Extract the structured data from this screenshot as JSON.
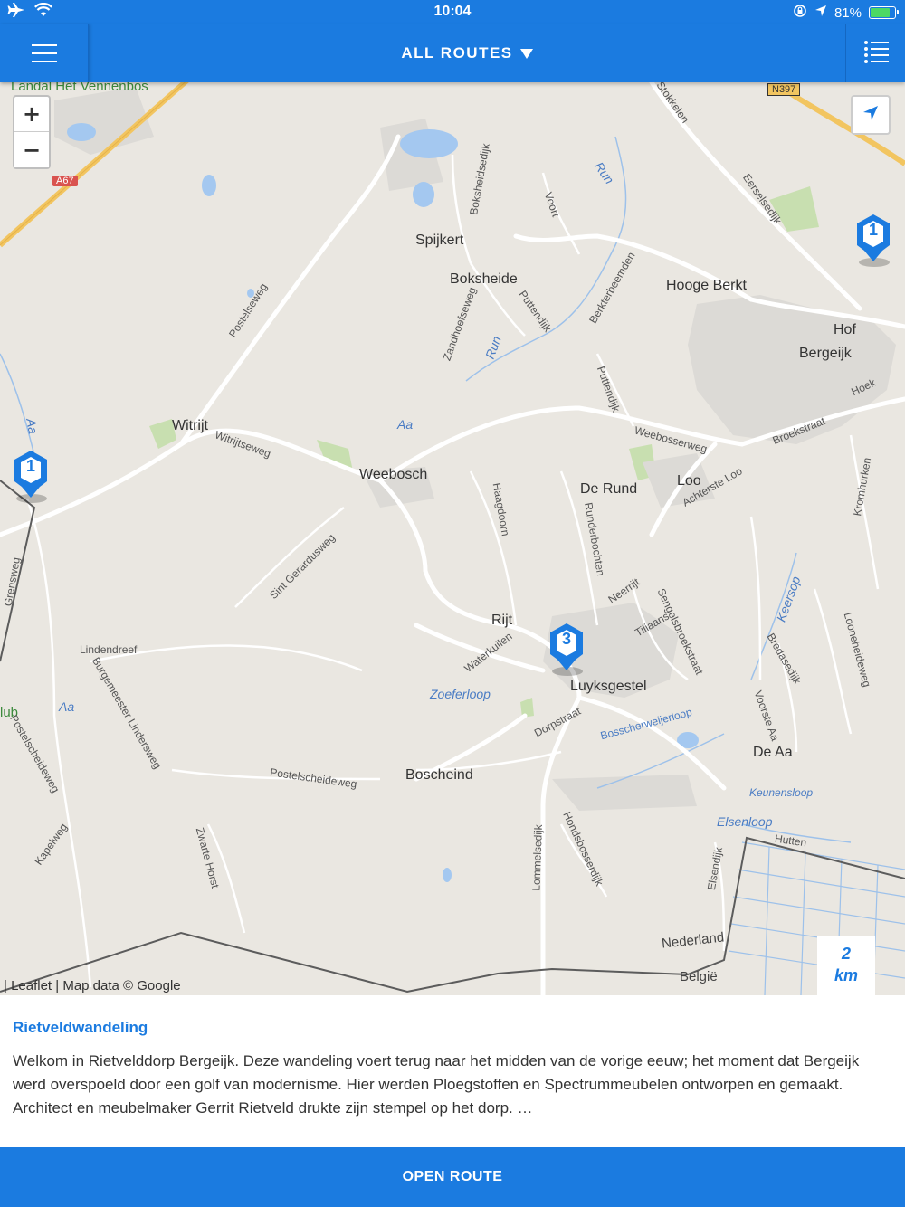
{
  "status_bar": {
    "time": "10:04",
    "battery": "81%",
    "battery_fraction": 0.81
  },
  "nav": {
    "title": "ALL ROUTES",
    "menu_icon": "hamburger-icon",
    "list_icon": "list-icon"
  },
  "map": {
    "zoom_in": "+",
    "zoom_out": "−",
    "attribution": "| Leaflet | Map data © Google",
    "scale_value": "2",
    "scale_unit": "km",
    "markers": [
      "1",
      "1",
      "3"
    ],
    "places": {
      "landal": "Landal Het Vennenbos",
      "spijkert": "Spijkert",
      "boksheide": "Boksheide",
      "hooge_berkt": "Hooge Berkt",
      "hof": "Hof",
      "bergeijk": "Bergeijk",
      "witrijt": "Witrijt",
      "weebosch": "Weebosch",
      "de_rund": "De Rund",
      "loo": "Loo",
      "rijt": "Rijt",
      "luyksgestel": "Luyksgestel",
      "bosscheind": "Boscheind",
      "de_aa": "De Aa",
      "nederland": "Nederland",
      "belgie": "België",
      "lub": "lub",
      "hoek": "Hoek"
    },
    "roads": {
      "a67": "A67",
      "n397": "N397",
      "postelseweg": "Postelseweg",
      "witrijtseweg": "Witrijtseweg",
      "sint_gerardusweg": "Sint Gerardusweg",
      "lindendreef": "Lindendreef",
      "burgemeester": "Burgemeester Lindersweg",
      "postelscheideweg1": "Postelscheideweg",
      "postelscheideweg2": "Postelscheideweg",
      "kapelweg": "Kapelweg",
      "zwarte_horst": "Zwarte Horst",
      "grensweg": "Grensweg",
      "zandhoefseweg": "Zandhoefseweg",
      "boksheidsedijk": "Boksheidsedijk",
      "voort": "Voort",
      "stokkelen": "Stokkelen",
      "eerselsedijk": "Eerselsedijk",
      "berkterbeemden": "Berkterbeemden",
      "puttendijk1": "Puttendijk",
      "puttendijk2": "Puttendijk",
      "weebosserweg": "Weebosserweg",
      "broekstraat": "Broekstraat",
      "achterste_loo": "Achterste Loo",
      "kromhurken": "Kromhurken",
      "haagdoorn": "Haagdoorn",
      "runderbochten": "Runderbochten",
      "neerrijt": "Neerrijt",
      "sengelsbroekstraat": "Sengelsbroekstraat",
      "tiliaans": "Tiliaans",
      "waterkuilen": "Waterkuilen",
      "dorpstraat": "Dorpstraat",
      "lommelsedijk": "Lommelsedijk",
      "hondsbosserdijk": "Hondsbosserdijk",
      "elsendijk": "Elsendijk",
      "hutten": "Hutten",
      "bredasedijk": "Bredasedijk",
      "voorste_aa": "Voorste Aa",
      "loonheideweg": "Looneheideweg"
    },
    "water": {
      "run1": "Run",
      "run2": "Run",
      "aa1": "Aa",
      "aa2": "Aa",
      "aa3": "Aa",
      "zoeferloop": "Zoeferloop",
      "bosscherweijerloop": "Bosscherweijerloop",
      "keersop": "Keersop",
      "keunensloop": "Keunensloop",
      "elsenloop": "Elsenloop"
    }
  },
  "route": {
    "title": "Rietveldwandeling",
    "description": "Welkom in Rietvelddorp Bergeijk. Deze wandeling voert terug naar het midden van de vorige eeuw; het moment dat Bergeijk werd overspoeld door een golf van modernisme. Hier werden Ploegstoffen en Spectrummeubelen ontworpen en gemaakt. Architect en meubelmaker Gerrit Rietveld drukte zijn stempel op het dorp. …"
  },
  "actions": {
    "open_route": "OPEN ROUTE"
  },
  "colors": {
    "primary": "#1b7be0",
    "map_background": "#eae7e1",
    "water": "#a4c8f0",
    "green_area": "#c8dfb0",
    "highway": "#f2c560"
  }
}
